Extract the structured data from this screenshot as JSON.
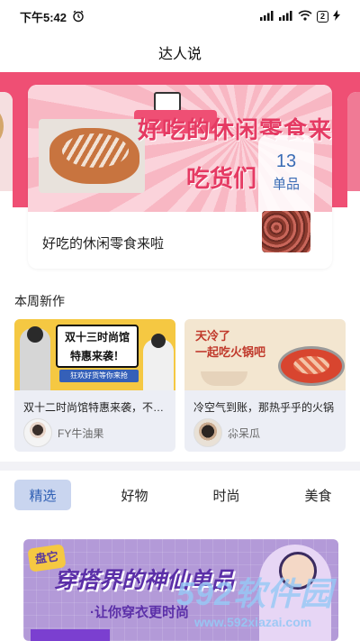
{
  "status_bar": {
    "time": "下午5:42",
    "battery": "2",
    "icons": [
      "alarm-icon",
      "signal-icon",
      "signal-icon",
      "wifi-icon",
      "battery-icon",
      "charging-icon"
    ]
  },
  "header": {
    "title": "达人说"
  },
  "banner": {
    "headline": "好吃的休闲零食来",
    "sub_headline": "吃货们",
    "caption": "好吃的休闲零食来啦",
    "count": "13",
    "count_unit": "单品"
  },
  "weekly": {
    "title": "本周新作",
    "items": [
      {
        "thumb_lines": [
          "双十三时尚馆",
          "特惠来袭！"
        ],
        "thumb_tag": "狂欢好货等你来抢",
        "desc": "双十二时尚馆特惠来袭，不要错过",
        "author": "FY牛油果"
      },
      {
        "thumb_lines": [
          "天冷了",
          "一起吃火锅吧"
        ],
        "desc": "冷空气到账，那热乎乎的火锅",
        "author": "尛呆瓜"
      }
    ]
  },
  "tabs": [
    {
      "label": "精选",
      "active": true
    },
    {
      "label": "好物",
      "active": false
    },
    {
      "label": "时尚",
      "active": false
    },
    {
      "label": "美食",
      "active": false
    }
  ],
  "feature": {
    "badge": "盘它",
    "title": "穿搭界的神仙单品",
    "subtitle": "·让你穿衣更时尚"
  },
  "watermark": {
    "big": "592软件园",
    "url": "www.592xiazai.com"
  },
  "colors": {
    "banner_pink": "#ef4f74",
    "accent_blue": "#2f5fb4",
    "tab_active_bg": "#c9d5ef",
    "feature_purple": "#b39ad8"
  }
}
